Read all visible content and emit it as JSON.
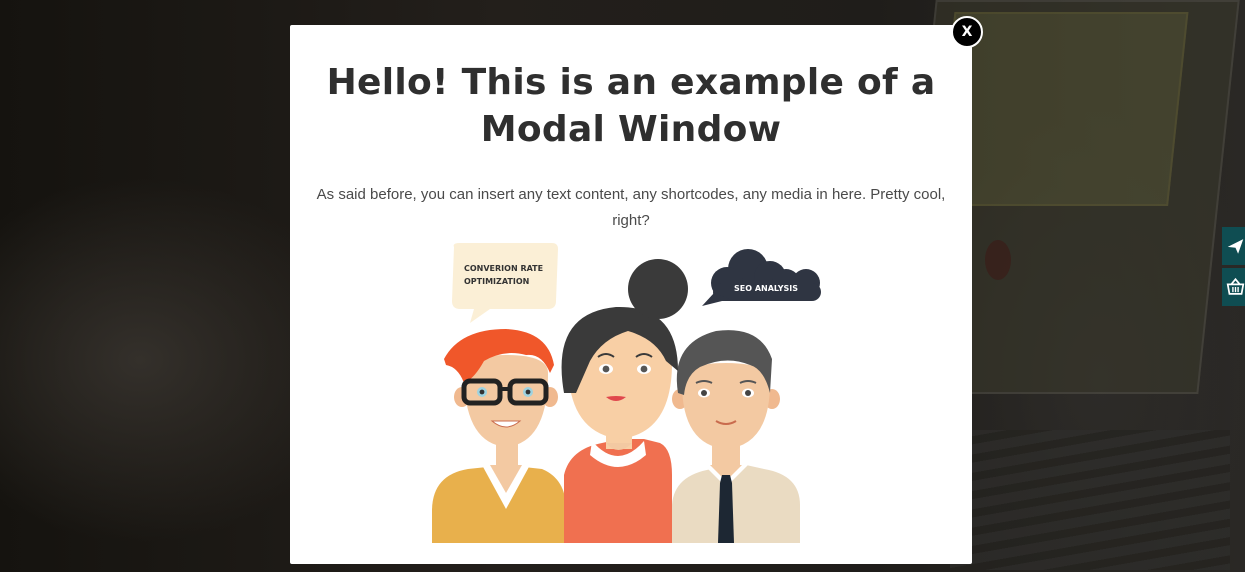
{
  "modal": {
    "title": "Hello! This is an example of a Modal Window",
    "body": "As said before, you can insert any text content, any shortcodes, any media in here. Pretty cool, right?",
    "close_label": "X"
  },
  "illustration": {
    "bubble_left": [
      "CONVERION RATE",
      "OPTIMIZATION"
    ],
    "bubble_right": "SEO ANALYSIS"
  },
  "colors": {
    "overlay": "#1c1a18",
    "modal_bg": "#ffffff",
    "title": "#2f2f2f",
    "side_widget": "#0f4d52"
  },
  "side_widgets": [
    {
      "icon": "paper-plane-icon"
    },
    {
      "icon": "basket-icon"
    }
  ]
}
